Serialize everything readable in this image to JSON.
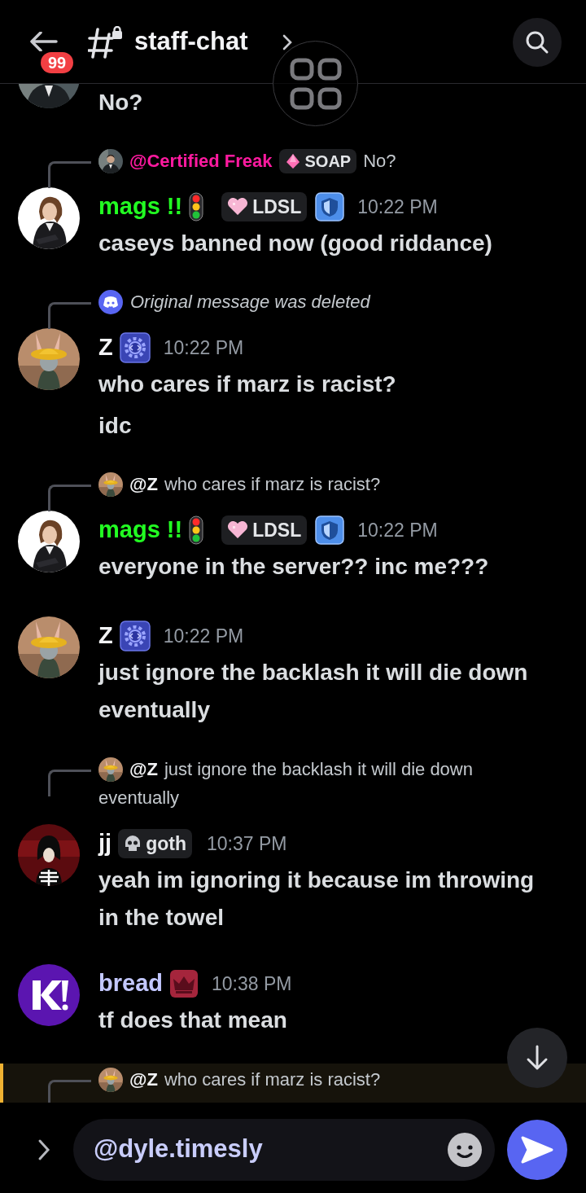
{
  "header": {
    "back_badge": "99",
    "channel": "staff-chat"
  },
  "messages": [
    {
      "kind": "partial",
      "highlighted": false,
      "paragraphs": [
        "No?"
      ]
    },
    {
      "kind": "full",
      "highlighted": false,
      "reply": {
        "kind": "message",
        "author": "@Certified Freak",
        "tag": {
          "kind": "gem-tag",
          "label": "SOAP"
        },
        "lines": [
          "No?"
        ]
      },
      "author": "mags !!",
      "badges": [
        {
          "kind": "traffic-light"
        },
        {
          "kind": "heart-tag",
          "label": "LDSL"
        },
        {
          "kind": "shield"
        }
      ],
      "time": "10:22 PM",
      "paragraphs": [
        "caseys banned now (good riddance)"
      ]
    },
    {
      "kind": "full",
      "highlighted": false,
      "reply": {
        "kind": "deleted",
        "lines": [
          "Original message was deleted"
        ]
      },
      "author": "Z",
      "badges": [
        {
          "kind": "gear"
        }
      ],
      "time": "10:22 PM",
      "paragraphs": [
        "who cares if marz is racist?",
        "idc"
      ]
    },
    {
      "kind": "full",
      "highlighted": false,
      "reply": {
        "kind": "message",
        "author": "@Z",
        "lines": [
          "who cares if marz is racist?"
        ]
      },
      "author": "mags !!",
      "badges": [
        {
          "kind": "traffic-light"
        },
        {
          "kind": "heart-tag",
          "label": "LDSL"
        },
        {
          "kind": "shield"
        }
      ],
      "time": "10:22 PM",
      "paragraphs": [
        "everyone in the server?? inc me???"
      ]
    },
    {
      "kind": "full",
      "highlighted": false,
      "author": "Z",
      "badges": [
        {
          "kind": "gear"
        }
      ],
      "time": "10:22 PM",
      "paragraphs": [
        "just ignore the backlash it will die down eventually"
      ]
    },
    {
      "kind": "full",
      "highlighted": false,
      "reply": {
        "kind": "message",
        "author": "@Z",
        "lines": [
          "just ignore the backlash it will die down",
          "eventually"
        ]
      },
      "author": "jj",
      "badges": [
        {
          "kind": "skull-tag",
          "label": "goth"
        }
      ],
      "time": "10:37 PM",
      "paragraphs": [
        "yeah im ignoring it because im throwing in the towel"
      ]
    },
    {
      "kind": "full",
      "highlighted": false,
      "author": "bread",
      "badges": [
        {
          "kind": "crown"
        }
      ],
      "time": "10:38 PM",
      "paragraphs": [
        "tf does that mean"
      ]
    },
    {
      "kind": "cut",
      "highlighted": true,
      "reply": {
        "kind": "message",
        "author": "@Z",
        "lines": [
          "who cares if marz is racist?"
        ]
      }
    }
  ],
  "composer": {
    "value": "@dyle.timesly"
  }
}
